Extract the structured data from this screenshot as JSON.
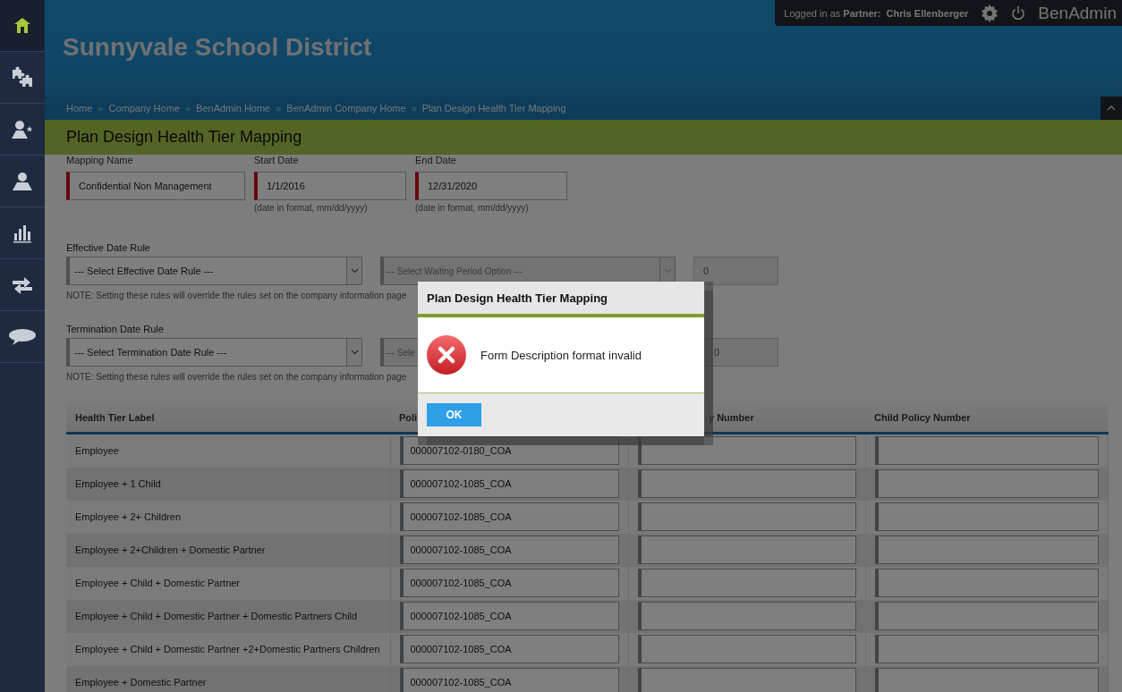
{
  "sidebar": {
    "items": [
      {
        "kind": "home",
        "selected": true
      },
      {
        "kind": "puzzle",
        "selected": false
      },
      {
        "kind": "person-star",
        "selected": false
      },
      {
        "kind": "person",
        "selected": false
      },
      {
        "kind": "chart",
        "selected": false
      },
      {
        "kind": "arrows",
        "selected": false
      },
      {
        "kind": "chat",
        "selected": false
      }
    ]
  },
  "header": {
    "title": "Sunnyvale School District",
    "user": "Logged in as **Partner:  Chris Ellenberger**",
    "app_name": "BenAdmin"
  },
  "breadcrumbs": {
    "separator": "»",
    "items": [
      "Home",
      "Company Home",
      "BenAdmin Home",
      "BenAdmin Company Home",
      "Plan Design Health Tier Mapping"
    ]
  },
  "page_title": "Plan Design Health Tier Mapping",
  "fields": [
    {
      "label": "Mapping Name",
      "value": "Confidential Non Management",
      "required": true
    },
    {
      "label": "Start Date",
      "value": "1/1/2016",
      "hint": "(date in format, mm/dd/yyyy)",
      "required": true
    },
    {
      "label": "End Date",
      "value": "12/31/2020",
      "hint": "(date in format, mm/dd/yyyy)",
      "required": true
    }
  ],
  "rules": [
    {
      "label": "Effective Date Rule",
      "select": "--- Select Effective Date Rule ---",
      "waiting_select": "--- Select Waiting Period Option ---",
      "days": "0",
      "note": "NOTE: Setting these rules will override the rules set on the company information page"
    },
    {
      "label": "Termination Date Rule",
      "select": "--- Select Termination Date Rule ---",
      "waiting_select": "--- Sele",
      "days": "0",
      "note": "NOTE: Setting these rules will override the rules set on the company information page"
    }
  ],
  "table": {
    "columns": [
      "Health Tier Label",
      "Poli",
      "y Number",
      "Child Policy Number"
    ],
    "rows": [
      {
        "label": "Employee",
        "policy": "000007102-0180_COA"
      },
      {
        "label": "Employee + 1 Child",
        "policy": "000007102-1085_COA"
      },
      {
        "label": "Employee + 2+ Children",
        "policy": "000007102-1085_COA"
      },
      {
        "label": "Employee + 2+Children + Domestic Partner",
        "policy": "000007102-1085_COA"
      },
      {
        "label": "Employee + Child + Domestic Partner",
        "policy": "000007102-1085_COA"
      },
      {
        "label": "Employee + Child + Domestic Partner + Domestic Partners Child",
        "policy": "000007102-1085_COA"
      },
      {
        "label": "Employee + Child + Domestic Partner +2+Domestic Partners Children",
        "policy": "000007102-1085_COA"
      },
      {
        "label": "Employee + Domestic Partner",
        "policy": "000007102-1085_COA"
      }
    ]
  },
  "dialog": {
    "title": "Plan Design Health Tier Mapping",
    "message": "Form Description format invalid",
    "buttons": [
      "OK"
    ]
  }
}
